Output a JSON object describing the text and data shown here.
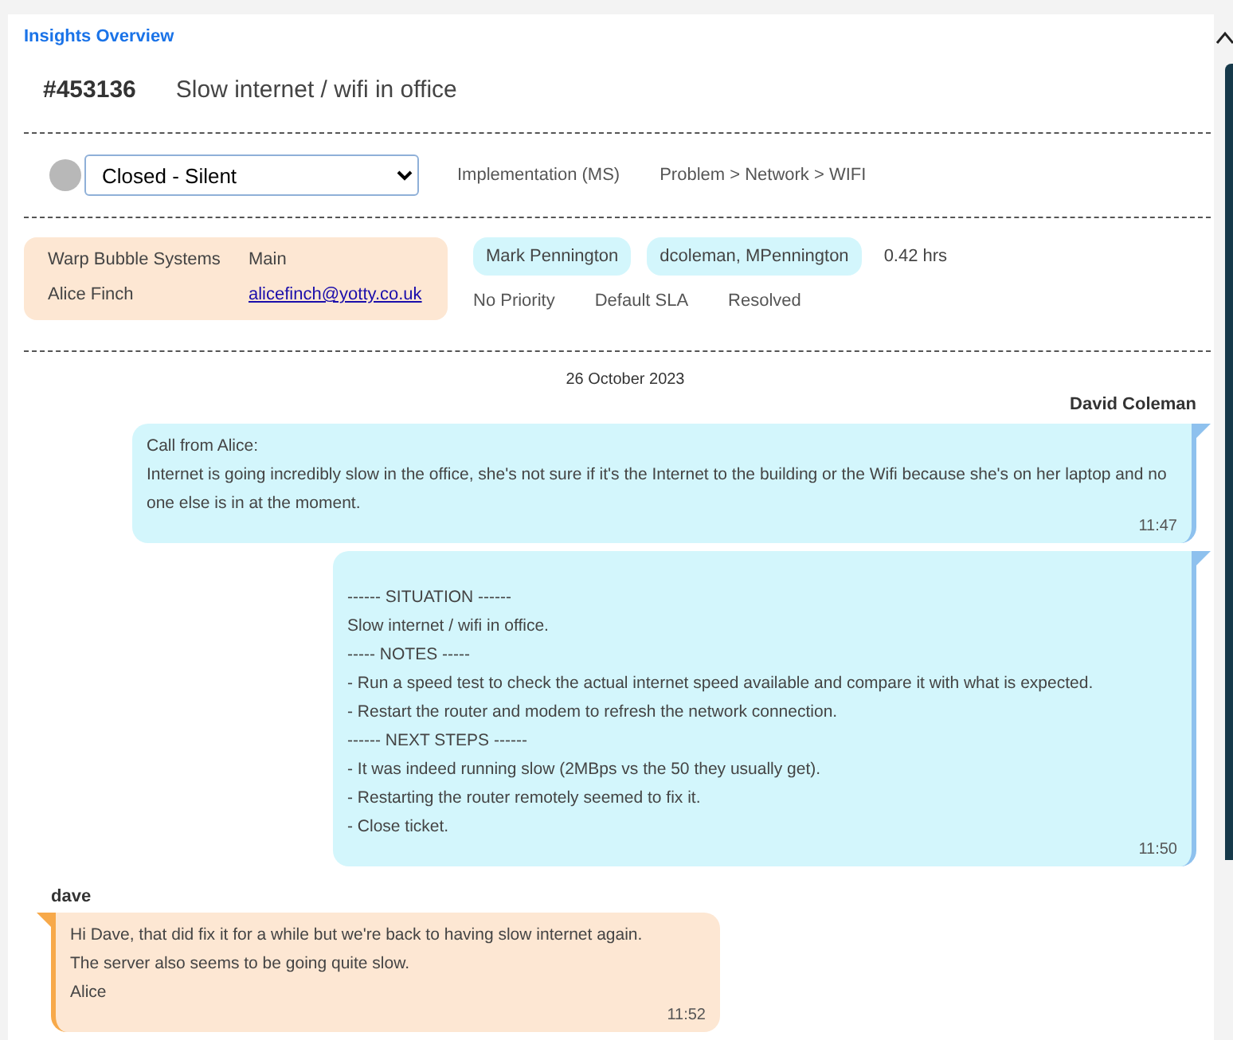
{
  "header": {
    "title": "Insights Overview"
  },
  "ticket": {
    "number": "#453136",
    "subject": "Slow internet / wifi in office"
  },
  "status": {
    "value": "Closed - Silent",
    "team": "Implementation (MS)",
    "category": "Problem > Network > WIFI"
  },
  "contact": {
    "company": "Warp Bubble Systems",
    "site": "Main",
    "name": "Alice Finch",
    "email": "alicefinch@yotty.co.uk"
  },
  "details": {
    "agents": [
      "Mark Pennington",
      "dcoleman, MPennington"
    ],
    "time": "0.42 hrs",
    "priority": "No Priority",
    "sla": "Default SLA",
    "state": "Resolved"
  },
  "date": "26 October 2023",
  "messages": [
    {
      "kind": "outgoing",
      "sender": "David Coleman",
      "lines": [
        "Call from Alice:",
        "Internet is going incredibly slow in the office, she's not sure if it's the Internet to the building or the Wifi because she's on her laptop and no one else is in at the moment."
      ],
      "time": "11:47"
    },
    {
      "kind": "outgoing",
      "lines": [
        "------ SITUATION ------",
        "Slow internet / wifi in office.",
        "----- NOTES -----",
        "- Run a speed test to check the actual internet speed available and compare it with what is expected.",
        "- Restart the router and modem to refresh the network connection.",
        "------ NEXT STEPS ------",
        "- It was indeed running slow (2MBps vs the 50 they usually get).",
        "- Restarting the router remotely seemed to fix it.",
        "- Close ticket."
      ],
      "time": "11:50",
      "spaced": true
    },
    {
      "kind": "incoming",
      "sender": "dave",
      "lines": [
        "Hi Dave, that did fix it for a while but we're back to having slow internet again.",
        "The server also seems to be going quite slow.",
        "Alice"
      ],
      "time": "11:52"
    }
  ]
}
